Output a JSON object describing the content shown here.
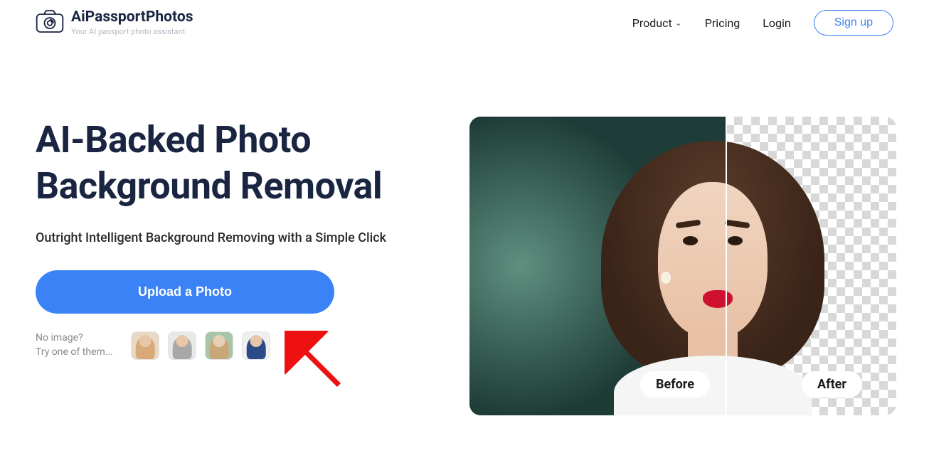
{
  "header": {
    "brandName": "AiPassportPhotos",
    "brandTag": "Your AI passport photo assistant.",
    "nav": {
      "product": "Product",
      "pricing": "Pricing",
      "login": "Login",
      "signup": "Sign up"
    }
  },
  "hero": {
    "title": "AI-Backed Photo Background Removal",
    "subtitle": "Outright Intelligent Background Removing with a Simple Click",
    "uploadLabel": "Upload a Photo",
    "samplesLine1": "No image?",
    "samplesLine2": "Try one of them...",
    "beforeLabel": "Before",
    "afterLabel": "After"
  }
}
